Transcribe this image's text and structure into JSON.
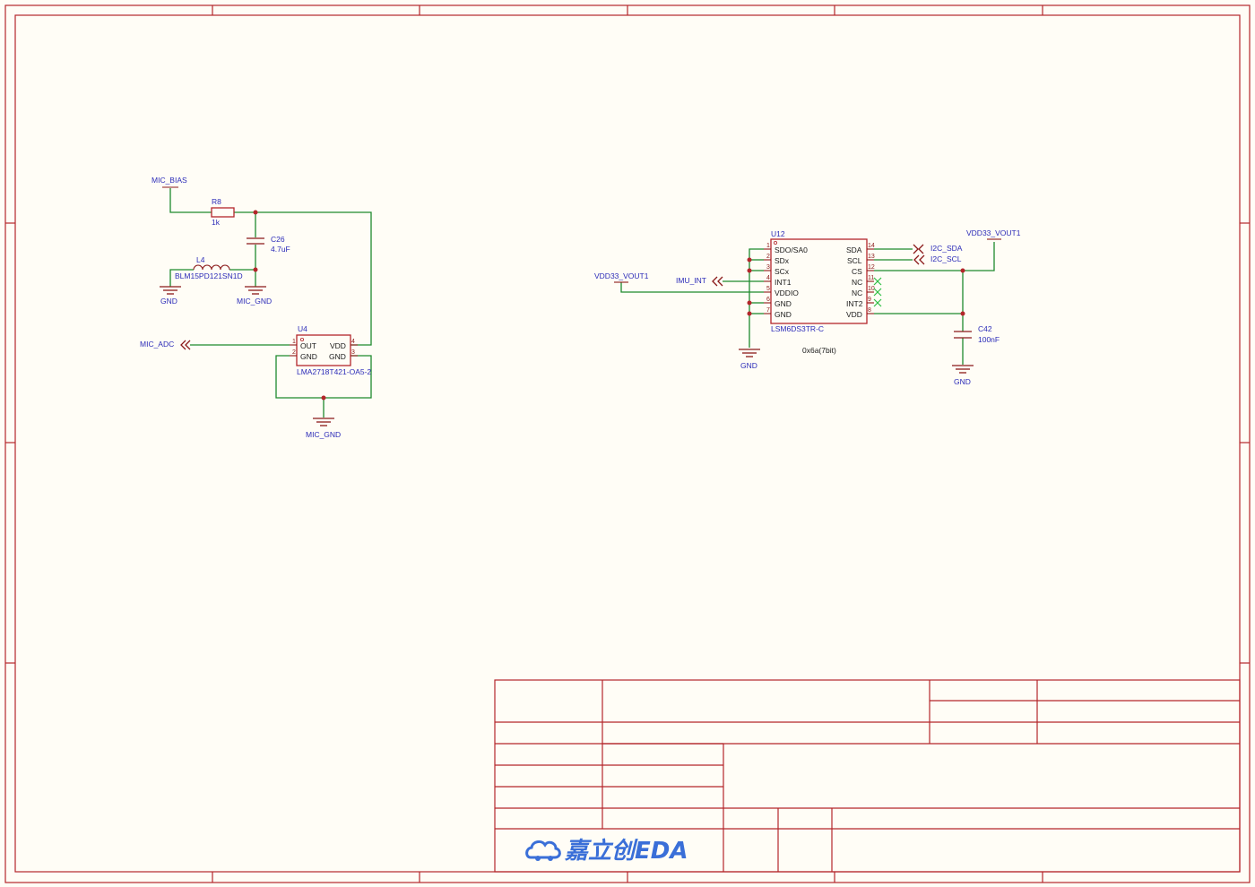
{
  "colors": {
    "background": "#FFFDF6",
    "frame": "#B3262B",
    "wire": "#1E8A2E",
    "net_label": "#2B2BB8",
    "no_connect": "#2FBF45",
    "logo": "#3A6FD8"
  },
  "mic_section": {
    "net_mic_bias": "MIC_BIAS",
    "r8": {
      "ref": "R8",
      "value": "1k"
    },
    "c26": {
      "ref": "C26",
      "value": "4.7uF"
    },
    "l4": {
      "ref": "L4",
      "value": "BLM15PD121SN1D"
    },
    "gnd_label": "GND",
    "mic_gnd_label_1": "MIC_GND",
    "mic_gnd_label_2": "MIC_GND",
    "net_mic_adc": "MIC_ADC",
    "u4": {
      "ref": "U4",
      "part": "LMA2718T421-OA5-2",
      "pins_left": [
        {
          "num": "1",
          "name": "OUT"
        },
        {
          "num": "2",
          "name": "GND"
        }
      ],
      "pins_right": [
        {
          "num": "4",
          "name": "VDD"
        },
        {
          "num": "3",
          "name": "GND"
        }
      ]
    }
  },
  "imu_section": {
    "u12": {
      "ref": "U12",
      "part": "LSM6DS3TR-C",
      "pins_left": [
        {
          "num": "1",
          "name": "SDO/SA0"
        },
        {
          "num": "2",
          "name": "SDx"
        },
        {
          "num": "3",
          "name": "SCx"
        },
        {
          "num": "4",
          "name": "INT1"
        },
        {
          "num": "5",
          "name": "VDDIO"
        },
        {
          "num": "6",
          "name": "GND"
        },
        {
          "num": "7",
          "name": "GND"
        }
      ],
      "pins_right": [
        {
          "num": "14",
          "name": "SDA"
        },
        {
          "num": "13",
          "name": "SCL"
        },
        {
          "num": "12",
          "name": "CS"
        },
        {
          "num": "11",
          "name": "NC"
        },
        {
          "num": "10",
          "name": "NC"
        },
        {
          "num": "9",
          "name": "INT2"
        },
        {
          "num": "8",
          "name": "VDD"
        }
      ]
    },
    "address_note": "0x6a(7bit)",
    "net_vdd33_left": "VDD33_VOUT1",
    "net_vdd33_right": "VDD33_VOUT1",
    "net_imu_int": "IMU_INT",
    "net_i2c_sda": "I2C_SDA",
    "net_i2c_scl": "I2C_SCL",
    "c42": {
      "ref": "C42",
      "value": "100nF"
    },
    "gnd_label_1": "GND",
    "gnd_label_2": "GND"
  },
  "title_block": {
    "logo_text": "嘉立创EDA",
    "logo_icon": "cloud-car-icon"
  }
}
